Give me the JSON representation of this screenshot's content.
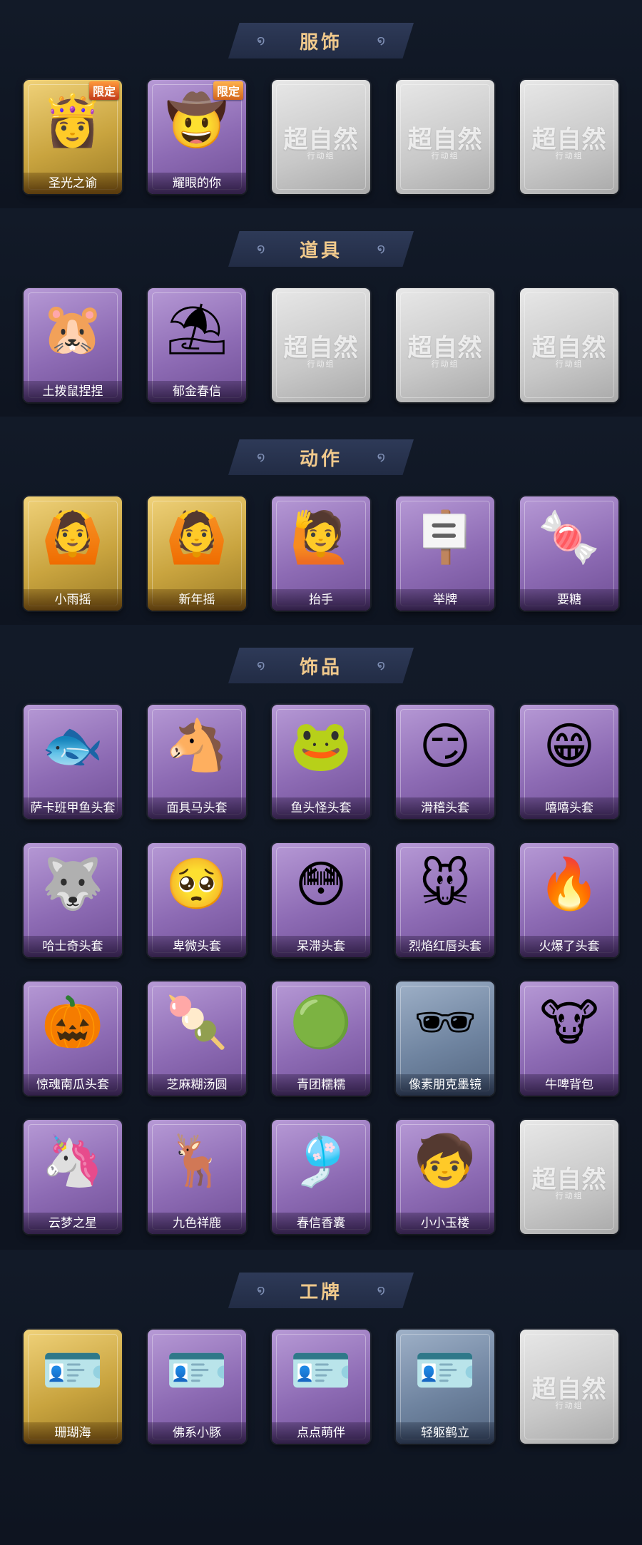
{
  "sections": [
    {
      "title": "服饰",
      "items": [
        {
          "label": "圣光之谕",
          "tier": "gold",
          "badge": "限定",
          "icon": "doll-icon"
        },
        {
          "label": "耀眼的你",
          "tier": "purple",
          "badge": "限定",
          "icon": "cowgirl-icon"
        },
        {
          "label": "",
          "tier": "empty",
          "icon": "placeholder-logo-icon"
        },
        {
          "label": "",
          "tier": "empty",
          "icon": "placeholder-logo-icon"
        },
        {
          "label": "",
          "tier": "empty",
          "icon": "placeholder-logo-icon"
        }
      ]
    },
    {
      "title": "道具",
      "items": [
        {
          "label": "土拨鼠捏捏",
          "tier": "purple",
          "icon": "groundhog-icon"
        },
        {
          "label": "郁金春信",
          "tier": "purple",
          "icon": "parasol-icon"
        },
        {
          "label": "",
          "tier": "empty",
          "icon": "placeholder-logo-icon"
        },
        {
          "label": "",
          "tier": "empty",
          "icon": "placeholder-logo-icon"
        },
        {
          "label": "",
          "tier": "empty",
          "icon": "placeholder-logo-icon"
        }
      ]
    },
    {
      "title": "动作",
      "items": [
        {
          "label": "小雨摇",
          "tier": "gold",
          "icon": "dance-pose-icon"
        },
        {
          "label": "新年摇",
          "tier": "gold",
          "icon": "dance-pose-icon"
        },
        {
          "label": "抬手",
          "tier": "purple",
          "icon": "raise-hand-icon"
        },
        {
          "label": "举牌",
          "tier": "purple",
          "icon": "hold-sign-icon"
        },
        {
          "label": "要糖",
          "tier": "purple",
          "icon": "ask-candy-icon"
        }
      ]
    },
    {
      "title": "饰品",
      "items": [
        {
          "label": "萨卡班甲鱼头套",
          "tier": "purple",
          "icon": "fish-head-icon"
        },
        {
          "label": "面具马头套",
          "tier": "purple",
          "icon": "horse-head-icon"
        },
        {
          "label": "鱼头怪头套",
          "tier": "purple",
          "icon": "green-fish-icon"
        },
        {
          "label": "滑稽头套",
          "tier": "purple",
          "icon": "smirk-emoji-icon"
        },
        {
          "label": "嘻嘻头套",
          "tier": "purple",
          "icon": "grin-emoji-icon"
        },
        {
          "label": "哈士奇头套",
          "tier": "purple",
          "icon": "husky-icon"
        },
        {
          "label": "卑微头套",
          "tier": "purple",
          "icon": "humble-emoji-icon"
        },
        {
          "label": "呆滞头套",
          "tier": "purple",
          "icon": "dazed-emoji-icon"
        },
        {
          "label": "烈焰红唇头套",
          "tier": "purple",
          "icon": "pikachu-icon"
        },
        {
          "label": "火爆了头套",
          "tier": "purple",
          "icon": "fire-icon"
        },
        {
          "label": "惊魂南瓜头套",
          "tier": "purple",
          "icon": "pumpkin-icon"
        },
        {
          "label": "芝麻糊汤圆",
          "tier": "purple",
          "icon": "dumpling-icon"
        },
        {
          "label": "青团糯糯",
          "tier": "purple",
          "icon": "green-rice-ball-icon"
        },
        {
          "label": "像素朋克墨镜",
          "tier": "blue",
          "icon": "pixel-sunglasses-icon"
        },
        {
          "label": "牛啤背包",
          "tier": "purple",
          "icon": "cow-beer-icon"
        },
        {
          "label": "云梦之星",
          "tier": "purple",
          "icon": "unicorn-icon"
        },
        {
          "label": "九色祥鹿",
          "tier": "purple",
          "icon": "deer-icon"
        },
        {
          "label": "春信香囊",
          "tier": "purple",
          "icon": "sachet-icon"
        },
        {
          "label": "小小玉楼",
          "tier": "purple",
          "icon": "chibi-icon"
        },
        {
          "label": "",
          "tier": "empty",
          "icon": "placeholder-logo-icon"
        }
      ]
    },
    {
      "title": "工牌",
      "items": [
        {
          "label": "珊瑚海",
          "tier": "gold",
          "icon": "badge-card-icon"
        },
        {
          "label": "佛系小豚",
          "tier": "purple",
          "icon": "badge-card-icon"
        },
        {
          "label": "点点萌伴",
          "tier": "purple",
          "icon": "badge-card-icon"
        },
        {
          "label": "轻躯鹤立",
          "tier": "blue",
          "icon": "badge-card-icon"
        },
        {
          "label": "",
          "tier": "empty",
          "icon": "placeholder-logo-icon"
        }
      ]
    }
  ],
  "placeholder": {
    "main": "超自然",
    "sub": "行动组"
  },
  "icon_glyphs": {
    "doll-icon": "👸",
    "cowgirl-icon": "🤠",
    "groundhog-icon": "🐹",
    "parasol-icon": "⛱",
    "dance-pose-icon": "🙆",
    "raise-hand-icon": "🙋",
    "hold-sign-icon": "🪧",
    "ask-candy-icon": "🍬",
    "fish-head-icon": "🐟",
    "horse-head-icon": "🐴",
    "green-fish-icon": "🐸",
    "smirk-emoji-icon": "😏",
    "grin-emoji-icon": "😁",
    "husky-icon": "🐺",
    "humble-emoji-icon": "🥺",
    "dazed-emoji-icon": "😳",
    "pikachu-icon": "🐭",
    "fire-icon": "🔥",
    "pumpkin-icon": "🎃",
    "dumpling-icon": "🍡",
    "green-rice-ball-icon": "🟢",
    "pixel-sunglasses-icon": "🕶",
    "cow-beer-icon": "🐮",
    "unicorn-icon": "🦄",
    "deer-icon": "🦌",
    "sachet-icon": "🎐",
    "chibi-icon": "🧒",
    "badge-card-icon": "🪪"
  }
}
